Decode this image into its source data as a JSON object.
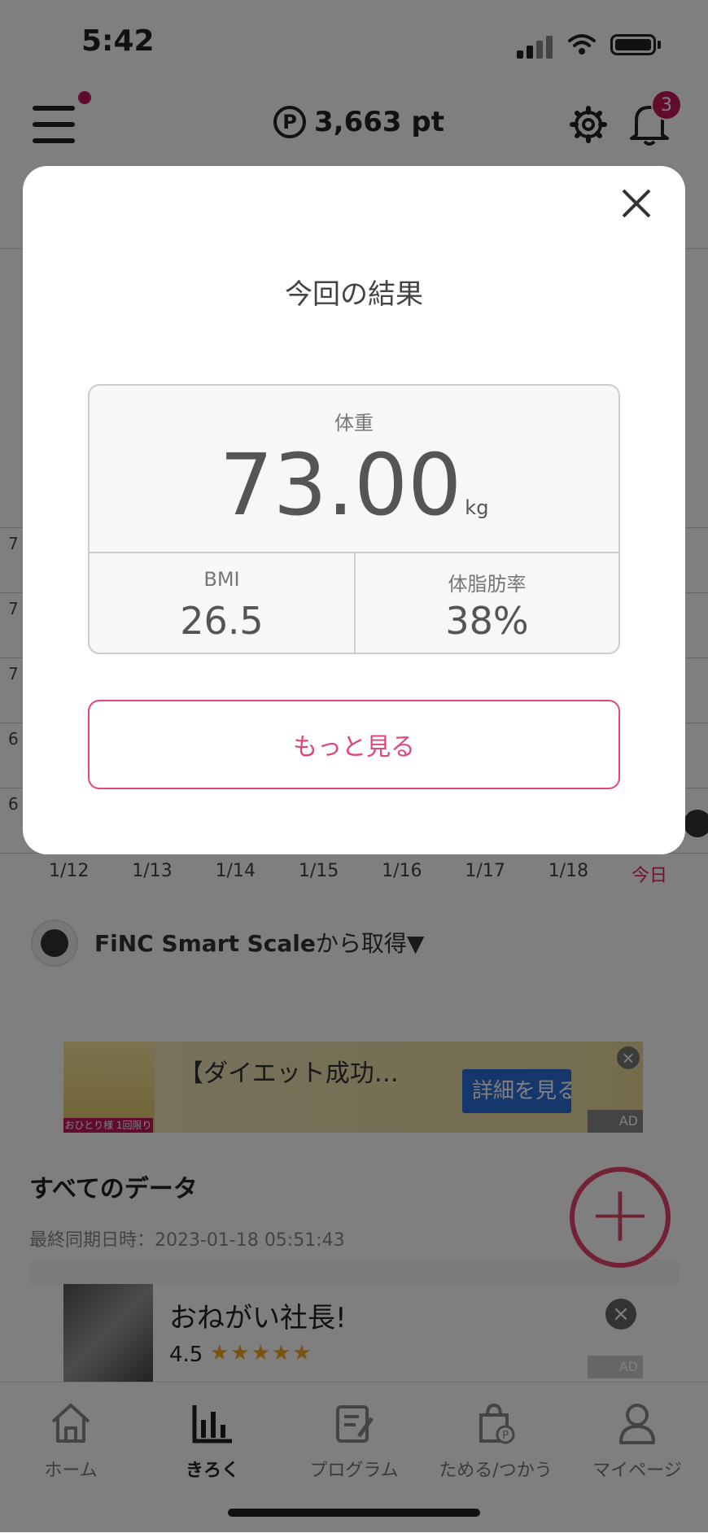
{
  "status_bar": {
    "time": "5:42"
  },
  "header": {
    "points": "3,663 pt",
    "points_icon": "P",
    "notification_count": "3",
    "icons": [
      "menu-icon",
      "gear-icon",
      "bell-icon"
    ]
  },
  "chart_bg": {
    "y_labels": [
      "7",
      "7",
      "7",
      "6",
      "6"
    ],
    "x_labels": [
      "1/12",
      "1/13",
      "1/14",
      "1/15",
      "1/16",
      "1/17",
      "1/18",
      "今日"
    ]
  },
  "source": {
    "name": "FiNC Smart Scale",
    "suffix": "から取得▼"
  },
  "ad1": {
    "title": "【ダイエット成功…",
    "button": "詳細を見る",
    "tag": "おひとり様 1回限り",
    "badge": "AD"
  },
  "section": {
    "title": "すべてのデータ",
    "last_sync": "最終同期日時：2023-01-18 05:51:43"
  },
  "ad2": {
    "title": "おねがい社長!",
    "rating": "4.5",
    "stars": "★★★★★",
    "badge": "AD"
  },
  "tabs": [
    {
      "label": "ホーム",
      "icon": "home-icon"
    },
    {
      "label": "きろく",
      "icon": "chart-icon"
    },
    {
      "label": "プログラム",
      "icon": "program-icon"
    },
    {
      "label": "ためる/つかう",
      "icon": "bag-icon"
    },
    {
      "label": "マイページ",
      "icon": "person-icon"
    }
  ],
  "modal": {
    "title": "今回の結果",
    "weight_label": "体重",
    "weight_value": "73.00",
    "weight_unit": "kg",
    "bmi_label": "BMI",
    "bmi_value": "26.5",
    "fat_label": "体脂肪率",
    "fat_value": "38%",
    "more_button": "もっと見る"
  },
  "colors": {
    "accent_pink": "#e0457b",
    "badge": "#c2185b"
  }
}
